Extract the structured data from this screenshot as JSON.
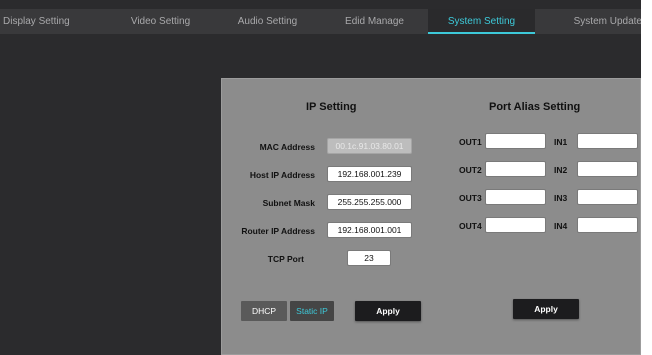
{
  "tabs": [
    {
      "label": "Display Setting",
      "active": false
    },
    {
      "label": "Video Setting",
      "active": false
    },
    {
      "label": "Audio Setting",
      "active": false
    },
    {
      "label": "Edid Manage",
      "active": false
    },
    {
      "label": "System Setting",
      "active": true
    },
    {
      "label": "System Update",
      "active": false
    }
  ],
  "ip_setting": {
    "title": "IP Setting",
    "mac_label": "MAC Address",
    "mac_value": "00.1c.91.03.80.01",
    "host_label": "Host IP Address",
    "host_value": "192.168.001.239",
    "subnet_label": "Subnet Mask",
    "subnet_value": "255.255.255.000",
    "router_label": "Router IP Address",
    "router_value": "192.168.001.001",
    "tcp_label": "TCP Port",
    "tcp_value": "23",
    "dhcp_label": "DHCP",
    "static_label": "Static IP",
    "apply_label": "Apply"
  },
  "port_alias": {
    "title": "Port Alias Setting",
    "outputs": [
      "OUT1",
      "OUT2",
      "OUT3",
      "OUT4"
    ],
    "inputs": [
      "IN1",
      "IN2",
      "IN3",
      "IN4"
    ],
    "apply_label": "Apply"
  },
  "colors": {
    "accent": "#3dc9d9",
    "background": "#2b2b2d",
    "tab_bar": "#39393b",
    "panel": "#8c8c8c"
  }
}
